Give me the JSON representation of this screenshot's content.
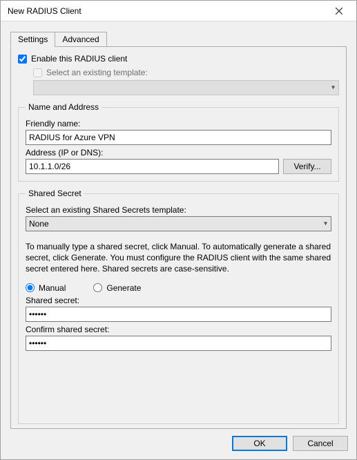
{
  "window": {
    "title": "New RADIUS Client"
  },
  "tabs": {
    "settings": "Settings",
    "advanced": "Advanced"
  },
  "enable": {
    "label": "Enable this RADIUS client",
    "checked": true
  },
  "template": {
    "label": "Select an existing template:",
    "checked": false,
    "selected": ""
  },
  "nameaddr": {
    "legend": "Name and Address",
    "friendly_label": "Friendly name:",
    "friendly_value": "RADIUS for Azure VPN",
    "address_label": "Address (IP or DNS):",
    "address_value": "10.1.1.0/26",
    "verify_btn": "Verify..."
  },
  "secret": {
    "legend": "Shared Secret",
    "template_label": "Select an existing Shared Secrets template:",
    "template_selected": "None",
    "help": "To manually type a shared secret, click Manual. To automatically generate a shared secret, click Generate. You must configure the RADIUS client with the same shared secret entered here. Shared secrets are case-sensitive.",
    "radio_manual": "Manual",
    "radio_generate": "Generate",
    "radio_selected": "manual",
    "shared_label": "Shared secret:",
    "shared_value": "••••••",
    "confirm_label": "Confirm shared secret:",
    "confirm_value": "••••••"
  },
  "buttons": {
    "ok": "OK",
    "cancel": "Cancel"
  }
}
